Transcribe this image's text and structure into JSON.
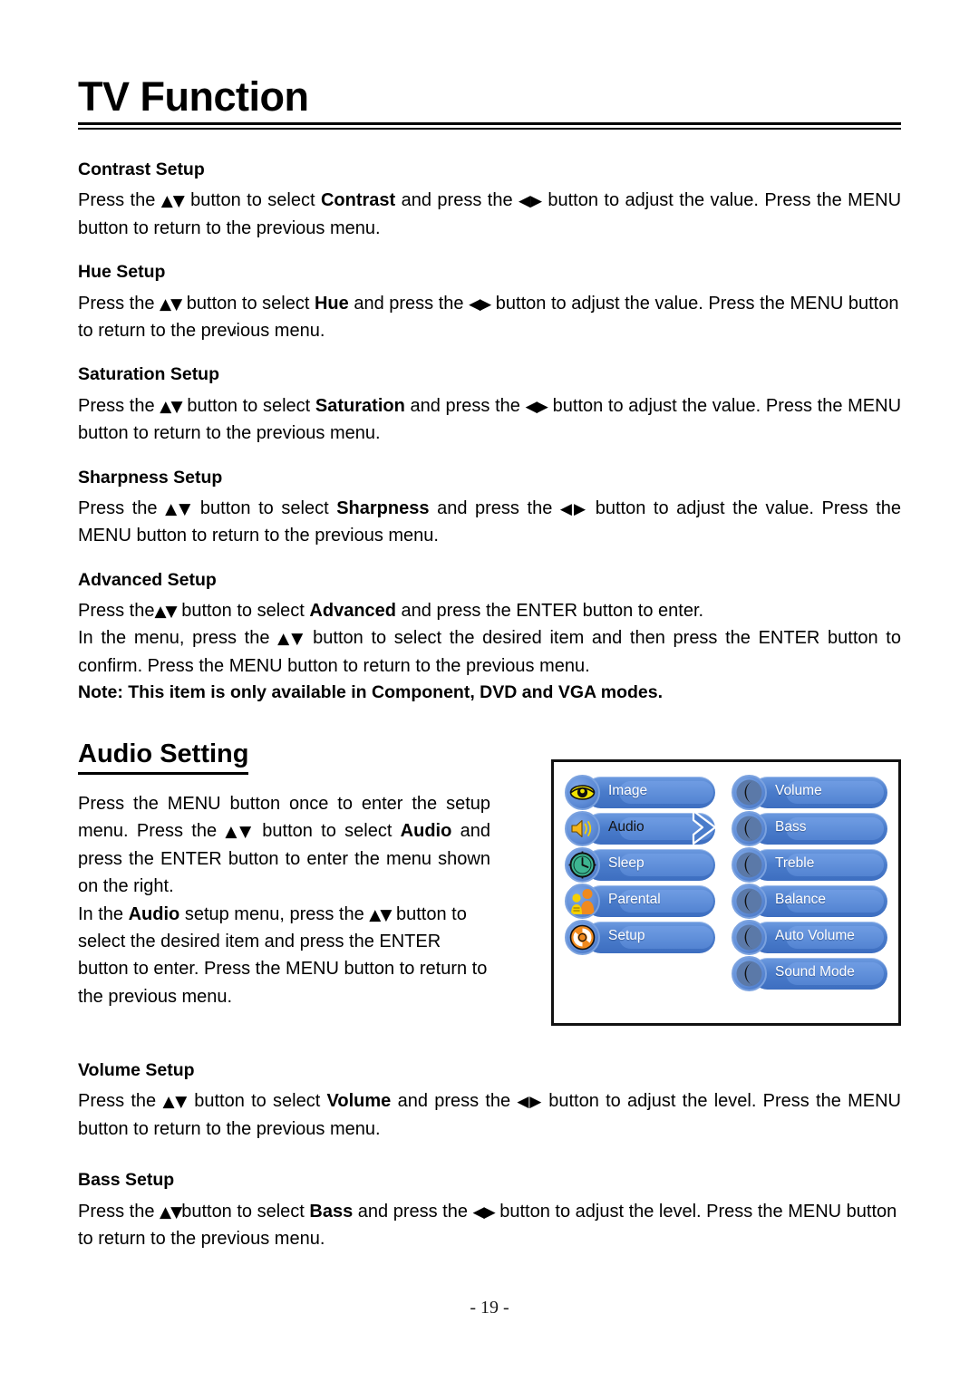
{
  "document": {
    "title": "TV Function",
    "page_number": "- 19 -"
  },
  "glyphs": {
    "up_down": "▲▼",
    "left_right": "◀▶"
  },
  "sections": [
    {
      "id": "contrast",
      "heading": "Contrast Setup",
      "body_parts": {
        "p1": "Press the ",
        "arrows1": "▲▼",
        "p2": " button to select ",
        "keyword": "Contrast",
        "p3": " and press the ",
        "arrows2": "◀▶",
        "p4": " button to adjust the value. Press the MENU button to return to the previous menu."
      }
    },
    {
      "id": "hue",
      "heading": "Hue Setup",
      "body_parts": {
        "p1": "Press the ",
        "arrows1": "▲▼",
        "p2": " button to select ",
        "keyword": "Hue",
        "p3": " and press the ",
        "arrows2": "◀▶",
        "p4": " button to adjust the value. Press the MENU button to return to the previous menu."
      }
    },
    {
      "id": "saturation",
      "heading": "Saturation Setup",
      "body_parts": {
        "p1": "Press the ",
        "arrows1": "▲▼",
        "p2": " button to select ",
        "keyword": "Saturation",
        "p3": " and press the ",
        "arrows2": "◀▶",
        "p4": " button to adjust the value. Press the MENU button to return to the previous menu."
      }
    },
    {
      "id": "sharpness",
      "heading": "Sharpness Setup",
      "body_parts": {
        "p1": "Press the ",
        "arrows1": "▲▼",
        "p2": " button to select ",
        "keyword": "Sharpness",
        "p3": " and press the ",
        "arrows2": "◀▶",
        "p4": " button to adjust the value. Press the MENU button to return to the previous menu."
      }
    }
  ],
  "advanced": {
    "heading": "Advanced Setup",
    "line1_a": "Press the",
    "line1_arrows": "▲▼",
    "line1_b": " button to select ",
    "line1_keyword": "Advanced",
    "line1_c": " and press the ENTER button to enter.",
    "line2_a": "In the menu, press the ",
    "line2_arrows": "▲▼",
    "line2_b": " button to select the desired item and then press the ENTER button to confirm. Press the MENU button to return to the previous menu.",
    "note": "Note: This item is only available in Component, DVD and VGA modes."
  },
  "audio_setting": {
    "heading": "Audio Setting",
    "para1_a": "Press the MENU button once to enter the setup menu. Press the ",
    "para1_arrows": "▲▼",
    "para1_b": " button to select ",
    "para1_keyword": "Audio",
    "para1_c": " and press the ENTER button to enter the menu shown on the right.",
    "para2_a": "In the ",
    "para2_keyword": "Audio",
    "para2_b": " setup menu, press the ",
    "para2_arrows": "▲▼",
    "para2_c": " button to select the desired item and press the ENTER button to enter. Press the MENU button to return to the previous menu."
  },
  "osd_menu": {
    "main_menu": [
      {
        "label": "Image",
        "icon": "eye-icon",
        "selected": false
      },
      {
        "label": "Audio",
        "icon": "speaker-icon",
        "selected": true
      },
      {
        "label": "Sleep",
        "icon": "clock-icon",
        "selected": false
      },
      {
        "label": "Parental",
        "icon": "parental-icon",
        "selected": false
      },
      {
        "label": "Setup",
        "icon": "refresh-gear-icon",
        "selected": false
      }
    ],
    "sub_menu": [
      {
        "label": "Volume",
        "icon": "crescent-icon"
      },
      {
        "label": "Bass",
        "icon": "crescent-icon"
      },
      {
        "label": "Treble",
        "icon": "crescent-icon"
      },
      {
        "label": "Balance",
        "icon": "crescent-icon"
      },
      {
        "label": "Auto Volume",
        "icon": "crescent-icon"
      },
      {
        "label": "Sound Mode",
        "icon": "crescent-icon"
      }
    ],
    "arrow_icon": "chevron-right-icon",
    "colors": {
      "pill": "#4a7ccb",
      "pill_highlight": "#6c9ae0",
      "label": "#ffffff",
      "label_selected": "#121212",
      "frame": "#111111"
    }
  },
  "bottom_sections": [
    {
      "id": "volume",
      "heading": "Volume Setup",
      "body_parts": {
        "p1": "Press the ",
        "arrows1": "▲▼",
        "p2": " button to select ",
        "keyword": "Volume",
        "p3": " and press the ",
        "arrows2": "◀▶",
        "p4": " button to adjust the level. Press the MENU button to return to the previous menu."
      }
    },
    {
      "id": "bass",
      "heading": "Bass Setup",
      "body_parts": {
        "p1": "Press the ",
        "arrows1": "▲▼",
        "p2": "button to select ",
        "keyword": "Bass",
        "p3": " and press the ",
        "arrows2": "◀▶",
        "p4": " button to adjust the level. Press the MENU button to return to the previous menu."
      }
    }
  ]
}
